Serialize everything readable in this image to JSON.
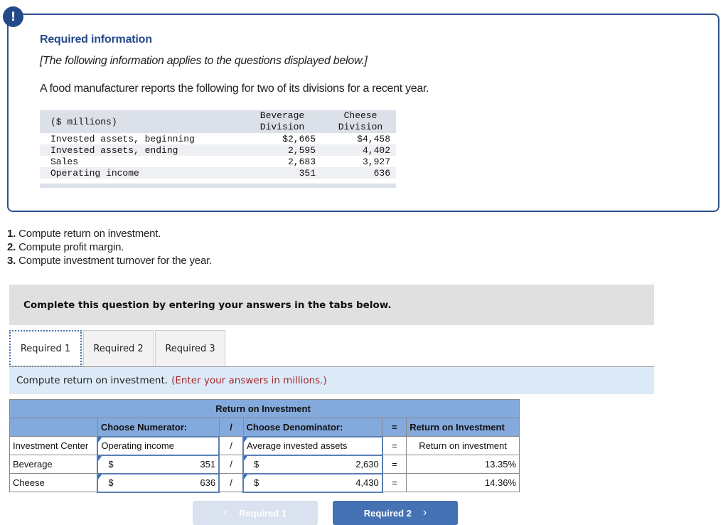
{
  "info": {
    "badge": "!",
    "title": "Required information",
    "note": "[The following information applies to the questions displayed below.]",
    "description": "A food manufacturer reports the following for two of its divisions for a recent year."
  },
  "data_table": {
    "unit_label": "($ millions)",
    "col1_header": [
      "Beverage",
      "Division"
    ],
    "col2_header": [
      "Cheese",
      "Division"
    ],
    "rows": [
      {
        "label": "Invested assets, beginning",
        "beverage": "$2,665",
        "cheese": "$4,458"
      },
      {
        "label": "Invested assets, ending",
        "beverage": "2,595",
        "cheese": "4,402"
      },
      {
        "label": "Sales",
        "beverage": "2,683",
        "cheese": "3,927"
      },
      {
        "label": "Operating income",
        "beverage": "351",
        "cheese": "636"
      }
    ]
  },
  "questions": [
    {
      "num": "1.",
      "text": "Compute return on investment."
    },
    {
      "num": "2.",
      "text": "Compute profit margin."
    },
    {
      "num": "3.",
      "text": "Compute investment turnover for the year."
    }
  ],
  "instruction": "Complete this question by entering your answers in the tabs below.",
  "tabs": [
    {
      "label": "Required 1",
      "active": true
    },
    {
      "label": "Required 2",
      "active": false
    },
    {
      "label": "Required 3",
      "active": false
    }
  ],
  "task": {
    "text": "Compute return on investment.",
    "hint": "(Enter your answers in millions.)"
  },
  "roi_table": {
    "title": "Return on Investment",
    "header": {
      "numerator": "Choose Numerator:",
      "slash": "/",
      "denominator": "Choose Denominator:",
      "equals": "=",
      "result": "Return on Investment"
    },
    "label_row": {
      "center": "Investment Center",
      "numerator": "Operating income",
      "slash": "/",
      "denominator": "Average invested assets",
      "equals": "=",
      "result": "Return on investment"
    },
    "rows": [
      {
        "center": "Beverage",
        "num_currency": "$",
        "numerator": "351",
        "slash": "/",
        "den_currency": "$",
        "denominator": "2,630",
        "equals": "=",
        "result": "13.35%"
      },
      {
        "center": "Cheese",
        "num_currency": "$",
        "numerator": "636",
        "slash": "/",
        "den_currency": "$",
        "denominator": "4,430",
        "equals": "=",
        "result": "14.36%"
      }
    ]
  },
  "nav": {
    "prev_label": "Required 1",
    "prev_icon": "‹",
    "next_label": "Required 2",
    "next_icon": "›"
  }
}
